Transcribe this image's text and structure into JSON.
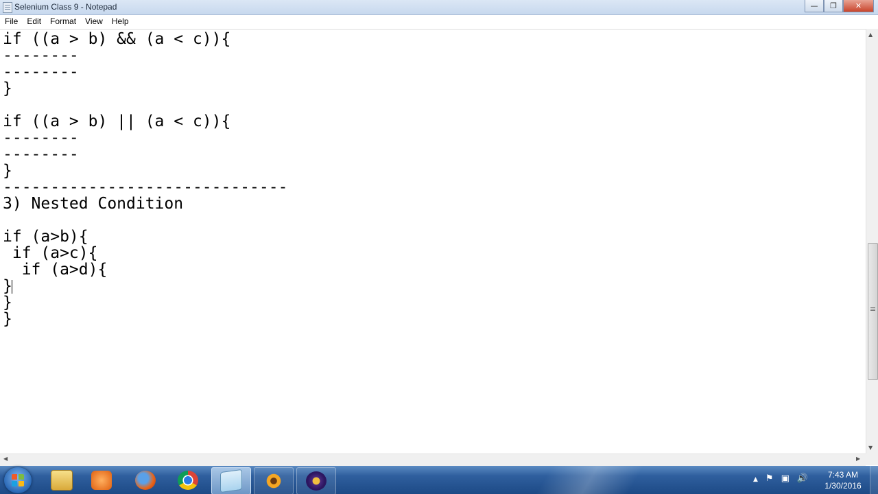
{
  "window": {
    "title": "Selenium Class 9 - Notepad"
  },
  "menu": [
    {
      "label": "File"
    },
    {
      "label": "Edit"
    },
    {
      "label": "Format"
    },
    {
      "label": "View"
    },
    {
      "label": "Help"
    }
  ],
  "editor": {
    "text": "if ((a > b) && (a < c)){\n--------\n--------\n}\n\nif ((a > b) || (a < c)){\n--------\n--------\n}\n------------------------------\n3) Nested Condition\n\nif (a>b){\n if (a>c){\n  if (a>d){\n}\n}\n}"
  },
  "taskbar": {
    "apps": [
      {
        "name": "windows-explorer-icon"
      },
      {
        "name": "media-player-icon"
      },
      {
        "name": "firefox-icon"
      },
      {
        "name": "chrome-icon"
      },
      {
        "name": "notepad-icon"
      },
      {
        "name": "paint-flower-icon"
      },
      {
        "name": "java-ee-ide-icon"
      }
    ],
    "clock": {
      "time": "7:43 AM",
      "date": "1/30/2016"
    }
  }
}
